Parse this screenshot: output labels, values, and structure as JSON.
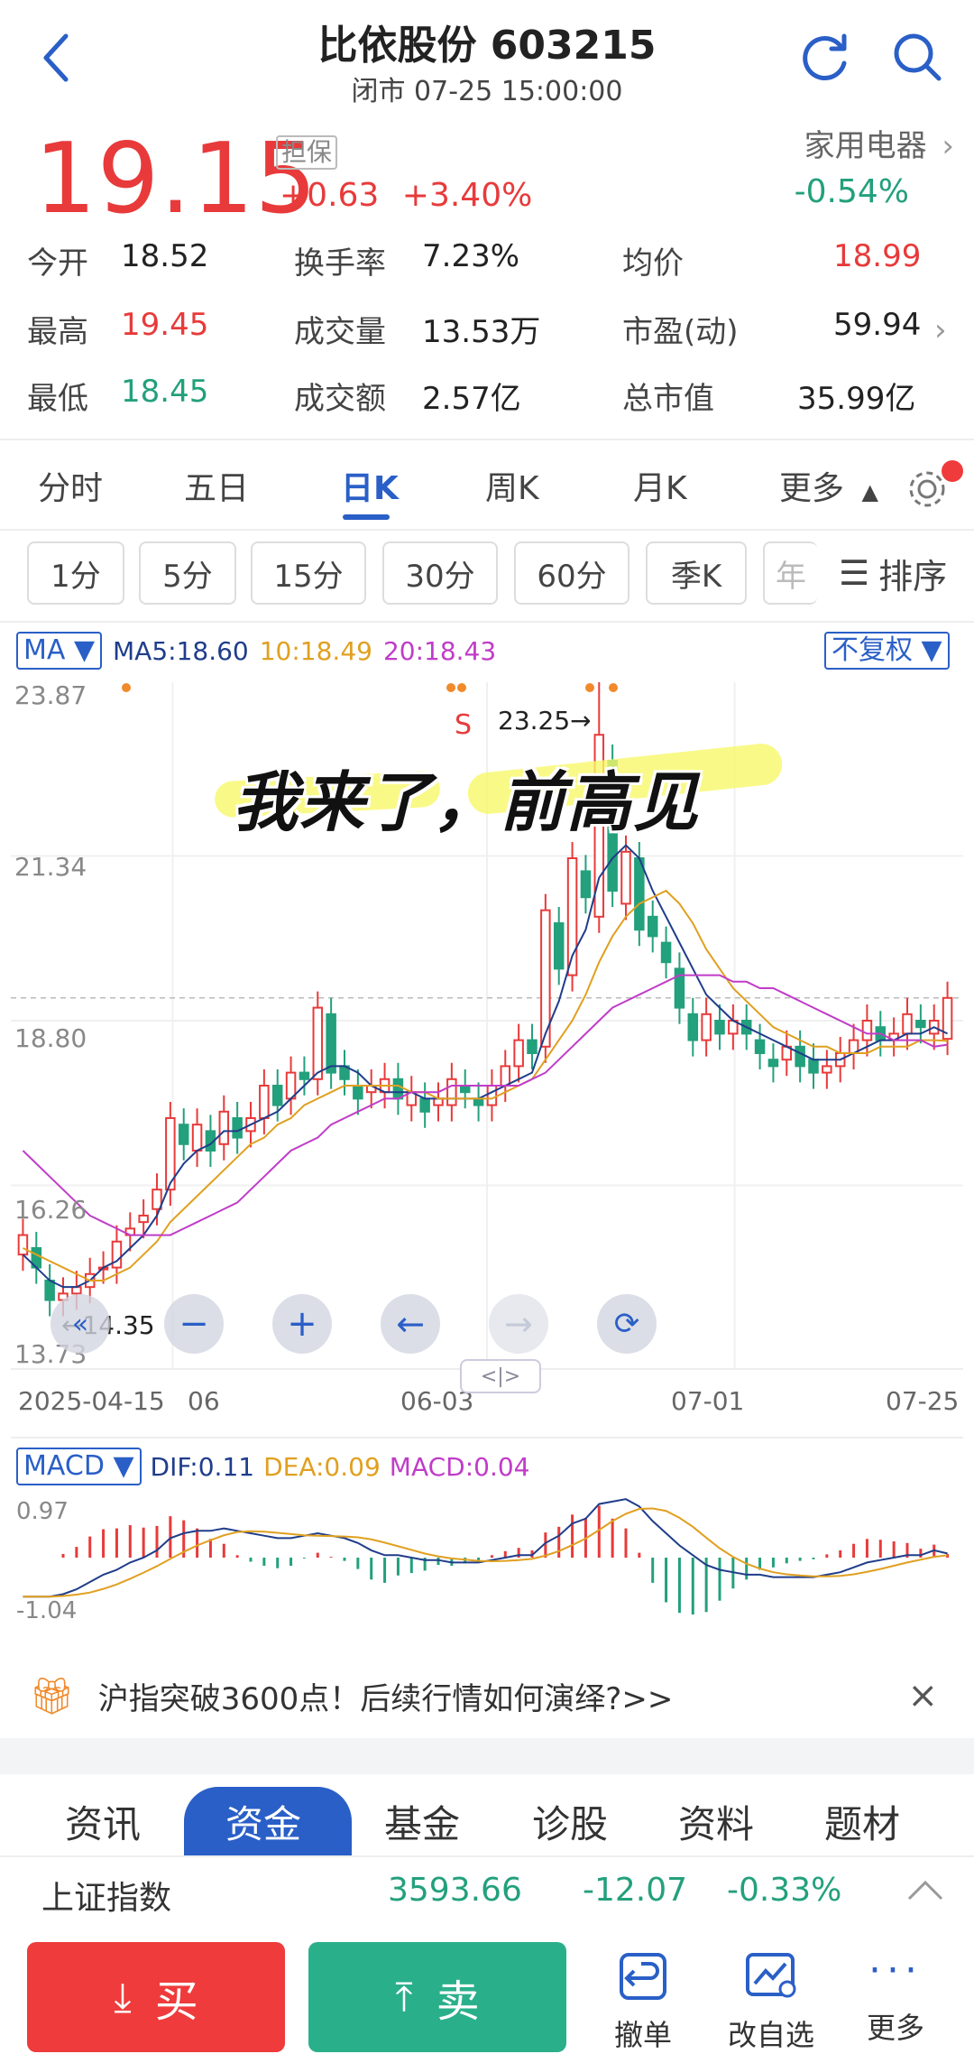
{
  "header": {
    "title": "比依股份 603215",
    "status": "闭市 07-25 15:00:00"
  },
  "quote": {
    "price": "19.15",
    "tag": "担保",
    "change": "+0.63",
    "change_pct": "+3.40%",
    "industry": "家用电器",
    "industry_change": "-0.54%"
  },
  "stats": {
    "open_label": "今开",
    "open": "18.52",
    "turnover_label": "换手率",
    "turnover": "7.23%",
    "avg_label": "均价",
    "avg": "18.99",
    "high_label": "最高",
    "high": "19.45",
    "volume_label": "成交量",
    "volume": "13.53万",
    "pe_label": "市盈(动)",
    "pe": "59.94",
    "low_label": "最低",
    "low": "18.45",
    "amount_label": "成交额",
    "amount": "2.57亿",
    "mcap_label": "总市值",
    "mcap": "35.99亿"
  },
  "period_tabs": [
    "分时",
    "五日",
    "日K",
    "周K",
    "月K",
    "更多"
  ],
  "active_period": "日K",
  "minute_pills": [
    "1分",
    "5分",
    "15分",
    "30分",
    "60分",
    "季K",
    "年"
  ],
  "sort_label": "排序",
  "ma_legend": {
    "dropdown": "MA",
    "ma5": "MA5:18.60",
    "ma10": "10:18.49",
    "ma20": "20:18.43",
    "adjust": "不复权"
  },
  "price_axis": [
    "23.87",
    "21.34",
    "18.80",
    "16.26",
    "13.73"
  ],
  "date_axis": [
    "2025-04-15",
    "06",
    "06-03",
    "07-01",
    "07-25"
  ],
  "annotations": {
    "high_label": "23.25→",
    "low_label": "←14.35",
    "sell_marker": "S",
    "overlay_text": "我来了，前高见",
    "collapse_handle": "<|>"
  },
  "macd_legend": {
    "dropdown": "MACD",
    "dif": "DIF:0.11",
    "dea": "DEA:0.09",
    "macd": "MACD:0.04",
    "top": "0.97",
    "bottom": "-1.04"
  },
  "banner": {
    "text": "沪指突破3600点！后续行情如何演绎?>>"
  },
  "bottom_tabs": [
    "资讯",
    "资金",
    "基金",
    "诊股",
    "资料",
    "题材"
  ],
  "active_bottom_tab": "资金",
  "index": {
    "name": "上证指数",
    "value": "3593.66",
    "change": "-12.07",
    "change_pct": "-0.33%"
  },
  "actions": {
    "buy": "买",
    "sell": "卖",
    "cancel": "撤单",
    "edit_watch": "改自选",
    "more": "更多"
  },
  "colors": {
    "up": "#e83a3a",
    "down": "#23a07c",
    "accent": "#2a5fc7",
    "ma5": "#1f3d8a",
    "ma10": "#e0a020",
    "ma20": "#c03cc8"
  },
  "chart_data": {
    "type": "candlestick",
    "x_range": [
      "2025-04-15",
      "2025-07-25"
    ],
    "ylim": [
      13.73,
      23.87
    ],
    "closes": [
      15.5,
      15.0,
      14.5,
      14.6,
      14.7,
      14.9,
      15.0,
      15.4,
      15.6,
      15.8,
      16.2,
      17.3,
      16.9,
      17.2,
      16.8,
      17.4,
      17.0,
      17.3,
      17.8,
      17.5,
      18.0,
      17.9,
      19.0,
      18.0,
      17.9,
      17.6,
      17.8,
      17.9,
      17.6,
      17.7,
      17.4,
      17.6,
      17.9,
      17.7,
      17.5,
      17.8,
      18.1,
      18.5,
      18.3,
      20.5,
      19.6,
      21.3,
      20.7,
      23.2,
      20.8,
      21.4,
      20.2,
      20.1,
      19.7,
      19.0,
      18.5,
      18.9,
      18.6,
      18.8,
      18.6,
      18.3,
      18.1,
      18.4,
      18.1,
      18.0,
      18.1,
      18.3,
      18.5,
      18.8,
      18.5,
      18.6,
      18.9,
      18.7,
      18.8,
      19.15
    ],
    "opens": [
      15.2,
      15.3,
      14.8,
      14.5,
      14.6,
      14.7,
      15.0,
      15.0,
      15.5,
      15.7,
      15.9,
      16.2,
      17.2,
      16.8,
      17.1,
      16.9,
      17.3,
      17.1,
      17.3,
      17.8,
      17.6,
      18.0,
      17.9,
      18.9,
      18.1,
      17.8,
      17.7,
      17.7,
      17.9,
      17.5,
      17.6,
      17.5,
      17.5,
      17.8,
      17.6,
      17.5,
      17.8,
      18.1,
      18.5,
      18.4,
      20.3,
      19.5,
      21.1,
      20.4,
      22.8,
      20.6,
      21.3,
      20.4,
      20.0,
      19.6,
      18.9,
      18.5,
      18.8,
      18.6,
      18.8,
      18.5,
      18.2,
      18.2,
      18.4,
      18.2,
      18.0,
      18.1,
      18.3,
      18.5,
      18.7,
      18.5,
      18.6,
      18.8,
      18.6,
      18.52
    ],
    "series": [
      {
        "name": "MA5",
        "values": [
          15.2,
          15.0,
          14.8,
          14.7,
          14.7,
          14.8,
          15.0,
          15.1,
          15.3,
          15.5,
          15.8,
          16.3,
          16.6,
          16.8,
          16.9,
          17.1,
          17.1,
          17.2,
          17.3,
          17.4,
          17.6,
          17.8,
          18.0,
          18.1,
          18.1,
          18.0,
          17.8,
          17.7,
          17.7,
          17.7,
          17.6,
          17.6,
          17.6,
          17.6,
          17.6,
          17.7,
          17.8,
          17.9,
          18.0,
          18.6,
          19.1,
          19.8,
          20.2,
          21.0,
          21.3,
          21.5,
          21.3,
          20.8,
          20.4,
          20.0,
          19.6,
          19.2,
          19.0,
          18.8,
          18.7,
          18.6,
          18.5,
          18.4,
          18.3,
          18.2,
          18.2,
          18.2,
          18.3,
          18.4,
          18.5,
          18.5,
          18.6,
          18.6,
          18.7,
          18.6
        ]
      },
      {
        "name": "MA10",
        "values": [
          15.3,
          15.2,
          15.1,
          15.0,
          14.9,
          14.8,
          14.8,
          14.9,
          15.0,
          15.2,
          15.4,
          15.7,
          15.9,
          16.1,
          16.3,
          16.5,
          16.7,
          16.9,
          17.0,
          17.2,
          17.3,
          17.5,
          17.6,
          17.7,
          17.8,
          17.8,
          17.8,
          17.8,
          17.8,
          17.7,
          17.7,
          17.6,
          17.6,
          17.6,
          17.6,
          17.6,
          17.7,
          17.8,
          17.9,
          18.2,
          18.5,
          18.8,
          19.2,
          19.7,
          20.1,
          20.4,
          20.6,
          20.7,
          20.8,
          20.6,
          20.3,
          19.9,
          19.6,
          19.3,
          19.1,
          18.9,
          18.7,
          18.6,
          18.5,
          18.4,
          18.4,
          18.3,
          18.3,
          18.3,
          18.4,
          18.4,
          18.4,
          18.5,
          18.5,
          18.49
        ]
      },
      {
        "name": "MA20",
        "values": [
          16.8,
          16.6,
          16.4,
          16.2,
          16.0,
          15.8,
          15.7,
          15.6,
          15.5,
          15.5,
          15.5,
          15.5,
          15.6,
          15.7,
          15.8,
          15.9,
          16.0,
          16.2,
          16.4,
          16.6,
          16.8,
          16.9,
          17.0,
          17.2,
          17.3,
          17.4,
          17.5,
          17.6,
          17.6,
          17.7,
          17.7,
          17.7,
          17.8,
          17.8,
          17.8,
          17.8,
          17.8,
          17.8,
          17.9,
          18.0,
          18.2,
          18.4,
          18.6,
          18.8,
          19.0,
          19.1,
          19.2,
          19.3,
          19.4,
          19.5,
          19.5,
          19.5,
          19.5,
          19.4,
          19.4,
          19.3,
          19.3,
          19.2,
          19.1,
          19.0,
          18.9,
          18.8,
          18.7,
          18.6,
          18.6,
          18.5,
          18.5,
          18.5,
          18.4,
          18.43
        ]
      }
    ]
  }
}
